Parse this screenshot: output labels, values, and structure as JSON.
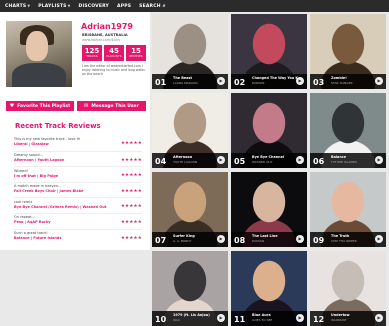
{
  "nav": {
    "items": [
      {
        "label": "CHARTS",
        "has_dropdown": true
      },
      {
        "label": "PLAYLISTS",
        "has_dropdown": true
      },
      {
        "label": "DISCOVERY",
        "has_dropdown": false
      },
      {
        "label": "APPS",
        "has_dropdown": false
      },
      {
        "label": "SEARCH",
        "has_dropdown": false
      }
    ]
  },
  "profile": {
    "username": "Adrian1979",
    "location": "BRISBANE, AUSTRALIA",
    "twitter": "www.twitter.com/4icky",
    "stats": [
      {
        "value": "125",
        "label": "TRACKS"
      },
      {
        "value": "45",
        "label": "PLAYLISTS"
      },
      {
        "value": "15",
        "label": "REVIEWS"
      }
    ],
    "bio": "I am the editor of weareduerted.com I enjoy listening to music and long walks on the beach",
    "favorite_label": "Favorite This Playlist",
    "message_label": "Message This User"
  },
  "reviews": {
    "title": "Recent Track Reviews",
    "items": [
      {
        "text": "This is my new favorite track - love it!",
        "track": "Liberal | Glassjaw",
        "rating": 5
      },
      {
        "text": "Dreamy sound...",
        "track": "Afternoon | Youth Lagoon",
        "rating": 5
      },
      {
        "text": "Wicked!",
        "track": "I'm off that | Big Paige",
        "rating": 5
      },
      {
        "text": "A match made in heaven...",
        "track": "Fall Creek Boys Choir | James Blake",
        "rating": 5
      },
      {
        "text": "cool remix",
        "track": "Bye Bye Channel (Grimes Remix) | Washed Out",
        "rating": 5
      },
      {
        "text": "On repeat...",
        "track": "Peso | A$AP Rocky",
        "rating": 5
      },
      {
        "text": "Such a great track!",
        "track": "Balance | Future Islands",
        "rating": 5
      }
    ]
  },
  "tiles": [
    {
      "num": "01",
      "song": "The Beast",
      "artist": "LAURA MARLING",
      "colors": [
        "#e6e2dd",
        "#9c8f84",
        "#2a2522"
      ]
    },
    {
      "num": "02",
      "song": "Changed The Way You K...",
      "artist": "DARWIN",
      "colors": [
        "#3a3540",
        "#c24a5c",
        "#1d1a20"
      ]
    },
    {
      "num": "03",
      "song": "Zombie!",
      "artist": "STAR SLINGER",
      "colors": [
        "#d8cdb8",
        "#7a5a3c",
        "#3a2b1f"
      ]
    },
    {
      "num": "04",
      "song": "Afternoon",
      "artist": "YOUTH LAGOON",
      "colors": [
        "#f0ece6",
        "#b09a86",
        "#3d2f27"
      ]
    },
    {
      "num": "05",
      "song": "Bye Bye Channel",
      "artist": "WASHED OUT",
      "colors": [
        "#302b33",
        "#c37b8a",
        "#0f0c10"
      ]
    },
    {
      "num": "06",
      "song": "Balance",
      "artist": "FUTURE ISLANDS",
      "colors": [
        "#7e8b8a",
        "#2f3536",
        "#f2f2f2"
      ]
    },
    {
      "num": "07",
      "song": "Surfer King",
      "artist": "A. A. BONDY",
      "colors": [
        "#7d6b58",
        "#c9a27c",
        "#3a2e24"
      ]
    },
    {
      "num": "08",
      "song": "The Last Line",
      "artist": "DAMIAN",
      "colors": [
        "#0c0b0d",
        "#d7b59e",
        "#8c3a4b"
      ]
    },
    {
      "num": "09",
      "song": "The Truth",
      "artist": "CHIP THA RIPPER",
      "colors": [
        "#c6c9ca",
        "#e6b8a0",
        "#6b4b38"
      ]
    },
    {
      "num": "10",
      "song": "1979 (ft. Lis Anjou)",
      "artist": "WAX",
      "colors": [
        "#a9a3a3",
        "#39363a",
        "#e2d7cf"
      ]
    },
    {
      "num": "11",
      "song": "Blue Aura",
      "artist": "GOES TO SEE",
      "colors": [
        "#2b3a58",
        "#dcb08c",
        "#1a1420"
      ]
    },
    {
      "num": "12",
      "song": "Undertow",
      "artist": "WARPAINT",
      "colors": [
        "#e8e3e0",
        "#c5bdb6",
        "#7b6a5e"
      ]
    }
  ]
}
